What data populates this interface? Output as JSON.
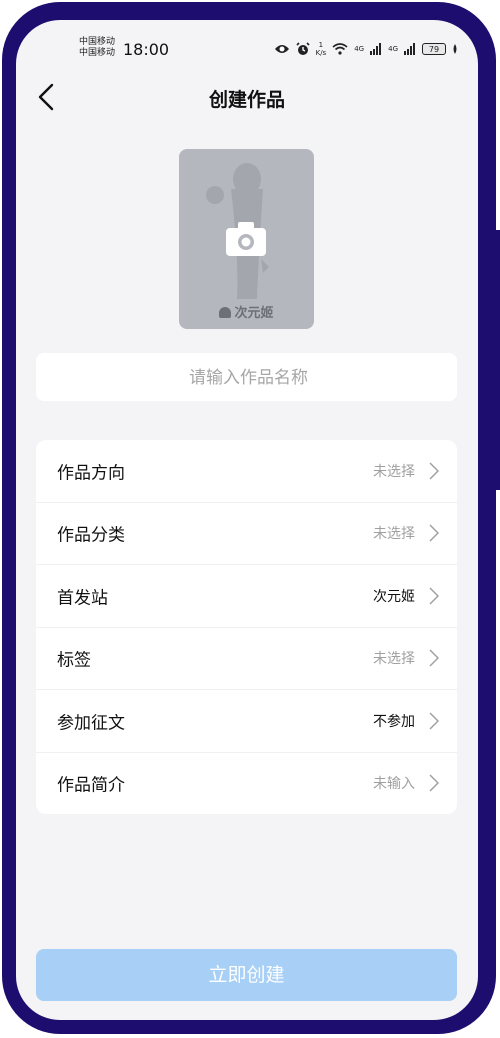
{
  "status_bar": {
    "carrier_1": "中国移动",
    "carrier_2": "中国移动",
    "time": "18:00",
    "net_speed_value": "1",
    "net_speed_unit": "K/s",
    "signal_1": "4G",
    "signal_2": "4G",
    "battery": "79"
  },
  "header": {
    "title": "创建作品"
  },
  "cover": {
    "logo_text": "次元姬"
  },
  "name_input": {
    "value": "",
    "placeholder": "请输入作品名称"
  },
  "settings": [
    {
      "label": "作品方向",
      "value": "未选择",
      "selected": false
    },
    {
      "label": "作品分类",
      "value": "未选择",
      "selected": false
    },
    {
      "label": "首发站",
      "value": "次元姬",
      "selected": true
    },
    {
      "label": "标签",
      "value": "未选择",
      "selected": false
    },
    {
      "label": "参加征文",
      "value": "不参加",
      "selected": true
    },
    {
      "label": "作品简介",
      "value": "未输入",
      "selected": false
    }
  ],
  "create_button": {
    "label": "立即创建"
  },
  "colors": {
    "bezel": "#1d0d6e",
    "background": "#f4f4f6",
    "button": "#a8cff5"
  }
}
